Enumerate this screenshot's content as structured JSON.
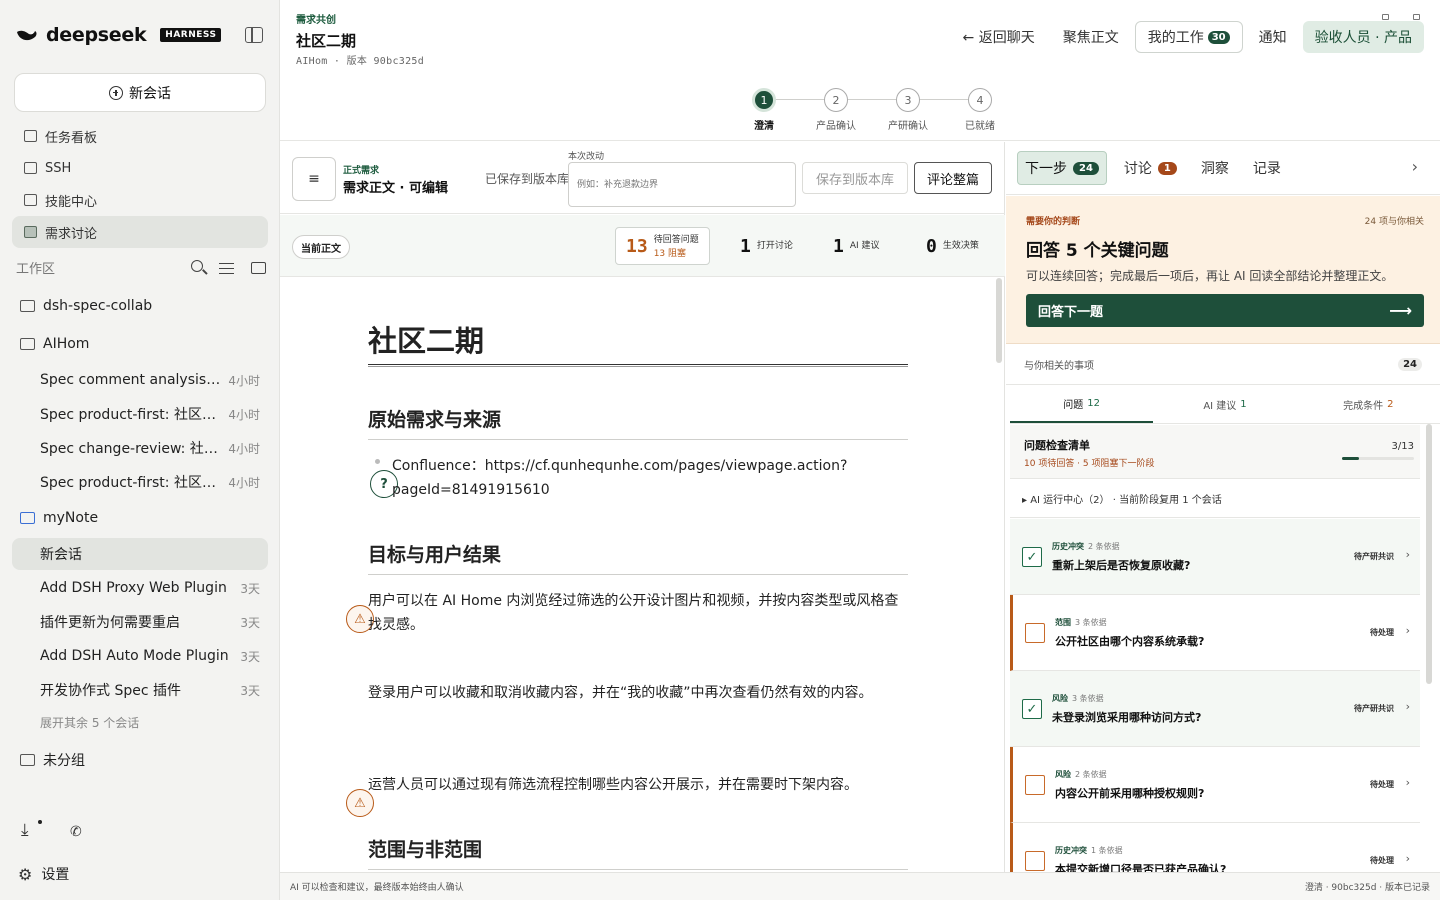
{
  "sidebar": {
    "brand": "deepseek",
    "brand_badge": "HARNESS",
    "new_chat": "新会话",
    "nav": [
      {
        "label": "任务看板",
        "icon": "board-icon"
      },
      {
        "label": "SSH",
        "icon": "terminal-icon"
      },
      {
        "label": "技能中心",
        "icon": "book-icon"
      },
      {
        "label": "需求讨论",
        "icon": "discussion-icon"
      }
    ],
    "workspace_label": "工作区",
    "folders": {
      "f1": "dsh-spec-collab",
      "f2": "AIHom",
      "f3": "myNote",
      "f4": "未分组"
    },
    "aihom_chats": [
      {
        "title": "Spec comment analysis: ...",
        "time": "4小时"
      },
      {
        "title": "Spec product-first: 社区二期",
        "time": "4小时"
      },
      {
        "title": "Spec change-review: 社区...",
        "time": "4小时"
      },
      {
        "title": "Spec product-first: 社区二期",
        "time": "4小时"
      }
    ],
    "mynote_chats": [
      {
        "title": "新会话",
        "time": ""
      },
      {
        "title": "Add DSH Proxy Web Plugin",
        "time": "3天"
      },
      {
        "title": "插件更新为何需要重启",
        "time": "3天"
      },
      {
        "title": "Add DSH Auto Mode Plugin",
        "time": "3天"
      },
      {
        "title": "开发协作式 Spec 插件",
        "time": "3天"
      }
    ],
    "expand_more": "展开其余 5 个会话",
    "settings": "设置"
  },
  "topbar": {
    "kicker": "需求共创",
    "title": "社区二期",
    "meta": "AIHom · 版本 90bc325d",
    "back": "← 返回聊天",
    "focus": "聚焦正文",
    "my_work": "我的工作",
    "my_work_count": "30",
    "notify": "通知",
    "role": "验收人员 · 产品"
  },
  "stepper": [
    {
      "num": "1",
      "label": "澄清",
      "active": true
    },
    {
      "num": "2",
      "label": "产品确认",
      "active": false
    },
    {
      "num": "3",
      "label": "产研确认",
      "active": false
    },
    {
      "num": "4",
      "label": "已就绪",
      "active": false
    }
  ],
  "editor": {
    "menu_icon": "≡",
    "req_kicker": "正式需求",
    "req_title": "需求正文 · 可编辑",
    "saved_hint": "已保存到版本库",
    "change_label": "本次改动",
    "change_placeholder": "例如：补充退款边界",
    "save_btn": "保存到版本库",
    "review_btn": "评论整篇",
    "current_pill": "当前正文",
    "stats": {
      "pending_n": "13",
      "pending_label": "待回答问题",
      "pending_sub": "13 阻塞",
      "open_n": "1",
      "open_label": "打开讨论",
      "ai_n": "1",
      "ai_label": "AI 建议",
      "decision_n": "0",
      "decision_label": "生效决策"
    }
  },
  "doc": {
    "h1": "社区二期",
    "s1_title": "原始需求与来源",
    "s1_bullet": "Confluence：https://cf.qunhequnhe.com/pages/viewpage.action?pageId=81491915610",
    "s2_title": "目标与用户结果",
    "p1": "用户可以在 AI Home 内浏览经过筛选的公开设计图片和视频，并按内容类型或风格查找灵感。",
    "p2": "登录用户可以收藏和取消收藏内容，并在“我的收藏”中再次查看仍然有效的内容。",
    "p3": "运营人员可以通过现有筛选流程控制哪些内容公开展示，并在需要时下架内容。",
    "s3_title": "范围与非范围"
  },
  "right": {
    "tabs": [
      {
        "label": "下一步",
        "badge": "24"
      },
      {
        "label": "讨论",
        "badge": "1"
      },
      {
        "label": "洞察",
        "badge": ""
      },
      {
        "label": "记录",
        "badge": ""
      }
    ],
    "judge_kicker": "需要你的判断",
    "judge_right": "24 项与你相关",
    "judge_title": "回答 5 个关键问题",
    "judge_desc": "可以连续回答；完成最后一项后，再让 AI 回读全部结论并整理正文。",
    "judge_btn": "回答下一题",
    "related_label": "与你相关的事项",
    "related_count": "24",
    "sub_tabs": [
      {
        "label": "问题",
        "num": "12"
      },
      {
        "label": "AI 建议",
        "num": "1"
      },
      {
        "label": "完成条件",
        "num": "2"
      }
    ],
    "checklist_title": "问题检查清单",
    "checklist_sub": "10 项待回答 · 5 项阻塞下一阶段",
    "checklist_ratio": "3/13",
    "checklist_progress": 0.23,
    "ai_run": "▸ AI 运行中心（2） · 当前阶段复用 1 个会话",
    "questions": [
      {
        "tag": "历史冲突",
        "evidence": "2 条依据",
        "title": "重新上架后是否恢复原收藏?",
        "status": "待产研共识",
        "done": true
      },
      {
        "tag": "范围",
        "evidence": "3 条依据",
        "title": "公开社区由哪个内容系统承载?",
        "status": "待处理",
        "done": false
      },
      {
        "tag": "风险",
        "evidence": "3 条依据",
        "title": "未登录浏览采用哪种访问方式?",
        "status": "待产研共识",
        "done": true
      },
      {
        "tag": "风险",
        "evidence": "2 条依据",
        "title": "内容公开前采用哪种授权规则?",
        "status": "待处理",
        "done": false
      },
      {
        "tag": "历史冲突",
        "evidence": "1 条依据",
        "title": "本提交新增口径是否已获产品确认?",
        "status": "待处理",
        "done": false
      }
    ]
  },
  "footer": {
    "left": "AI 可以检查和建议，最终版本始终由人确认",
    "right": "澄清 · 90bc325d · 版本已记录"
  },
  "colors": {
    "accent": "#1e4f3a",
    "warn": "#b85a18",
    "judge_bg": "#fdf1e2"
  }
}
